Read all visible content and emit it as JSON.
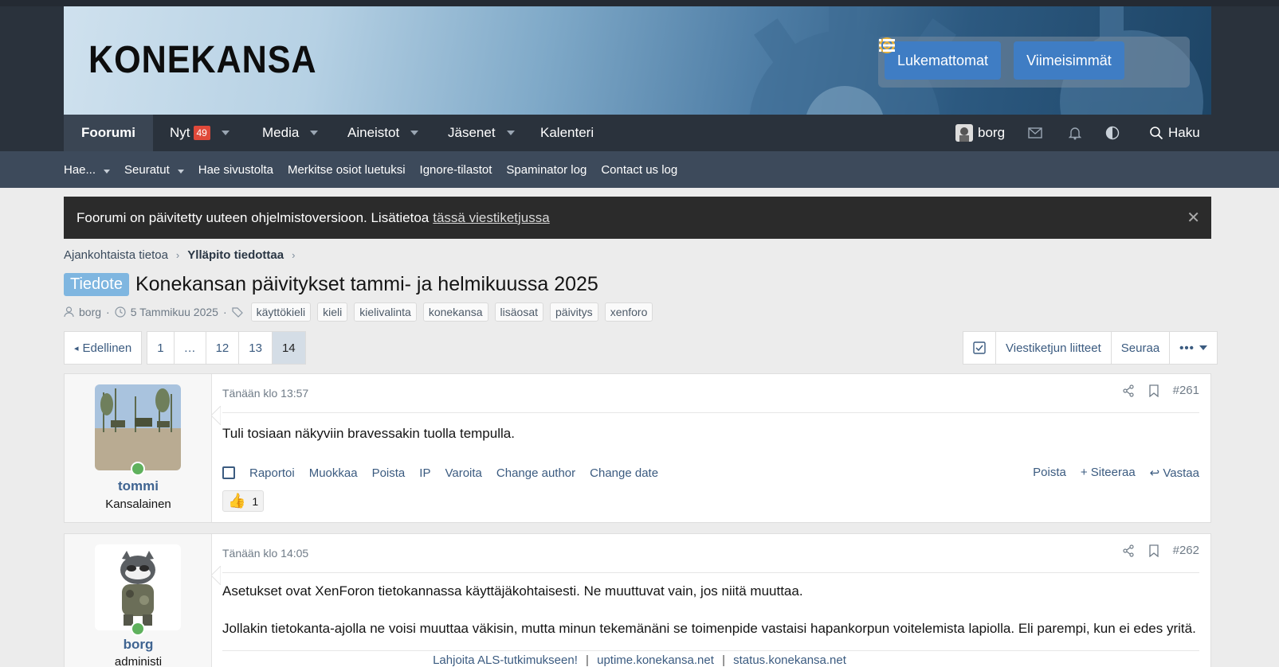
{
  "header": {
    "logo": "KONEKANSA",
    "buttons": [
      {
        "label": "Lukemattomat",
        "icon": "target-icon"
      },
      {
        "label": "Viimeisimmät",
        "icon": "list-icon"
      }
    ]
  },
  "nav": {
    "items": [
      {
        "label": "Foorumi",
        "active": true
      },
      {
        "label": "Nyt",
        "badge": "49",
        "dropdown": true
      },
      {
        "label": "Media",
        "dropdown": true
      },
      {
        "label": "Aineistot",
        "dropdown": true
      },
      {
        "label": "Jäsenet",
        "dropdown": true
      },
      {
        "label": "Kalenteri"
      }
    ],
    "user": "borg",
    "search_label": "Haku"
  },
  "subnav": {
    "items": [
      "Hae...",
      "Seuratut",
      "Hae sivustolta",
      "Merkitse osiot luetuksi",
      "Ignore-tilastot",
      "Spaminator log",
      "Contact us log"
    ]
  },
  "notice": {
    "text": "Foorumi on päivitetty uuteen ohjelmistoversioon. Lisätietoa",
    "link": "tässä viestiketjussa"
  },
  "breadcrumb": [
    "Ajankohtaista tietoa",
    "Ylläpito tiedottaa"
  ],
  "thread": {
    "prefix": "Tiedote",
    "title": "Konekansan päivitykset tammi- ja helmikuussa 2025",
    "author": "borg",
    "date": "5 Tammikuu 2025",
    "tags": [
      "käyttökieli",
      "kieli",
      "kielivalinta",
      "konekansa",
      "lisäosat",
      "päivitys",
      "xenforo"
    ]
  },
  "pager": {
    "prev": "Edellinen",
    "pages": [
      "1",
      "…",
      "12",
      "13",
      "14"
    ],
    "current": "14"
  },
  "thread_actions": [
    "Viestiketjun liitteet",
    "Seuraa",
    "•••"
  ],
  "posts": [
    {
      "time": "Tänään klo 13:57",
      "number": "#261",
      "username": "tommi",
      "user_title": "Kansalainen",
      "text": [
        "Tuli tosiaan näkyviin bravessakin tuolla tempulla."
      ],
      "links": [
        "Raportoi",
        "Muokkaa",
        "Poista",
        "IP",
        "Varoita",
        "Change author",
        "Change date"
      ],
      "right_links": [
        "Poista",
        "+ Siteeraa",
        "Vastaa"
      ],
      "reactions": "1"
    },
    {
      "time": "Tänään klo 14:05",
      "number": "#262",
      "username": "borg",
      "user_title": "administi",
      "text": [
        "Asetukset ovat XenForon tietokannassa käyttäjäkohtaisesti. Ne muuttuvat vain, jos niitä muuttaa.",
        "Jollakin tietokanta-ajolla ne voisi muuttaa väkisin, mutta minun tekemänäni se toimenpide vastaisi hapankorpun voitelemista lapiolla. Eli parempi, kun ei edes yritä."
      ]
    }
  ],
  "footer": {
    "links": [
      "Lahjoita ALS-tutkimukseen!",
      "uptime.konekansa.net",
      "status.konekansa.net"
    ]
  },
  "colors": {
    "nav_bg": "#2a323c",
    "subnav_bg": "#3d4a5b",
    "button_blue": "#3f7dc4",
    "link": "#3b5b80",
    "prefix": "#7fb6e0",
    "badge": "#e0493a"
  }
}
